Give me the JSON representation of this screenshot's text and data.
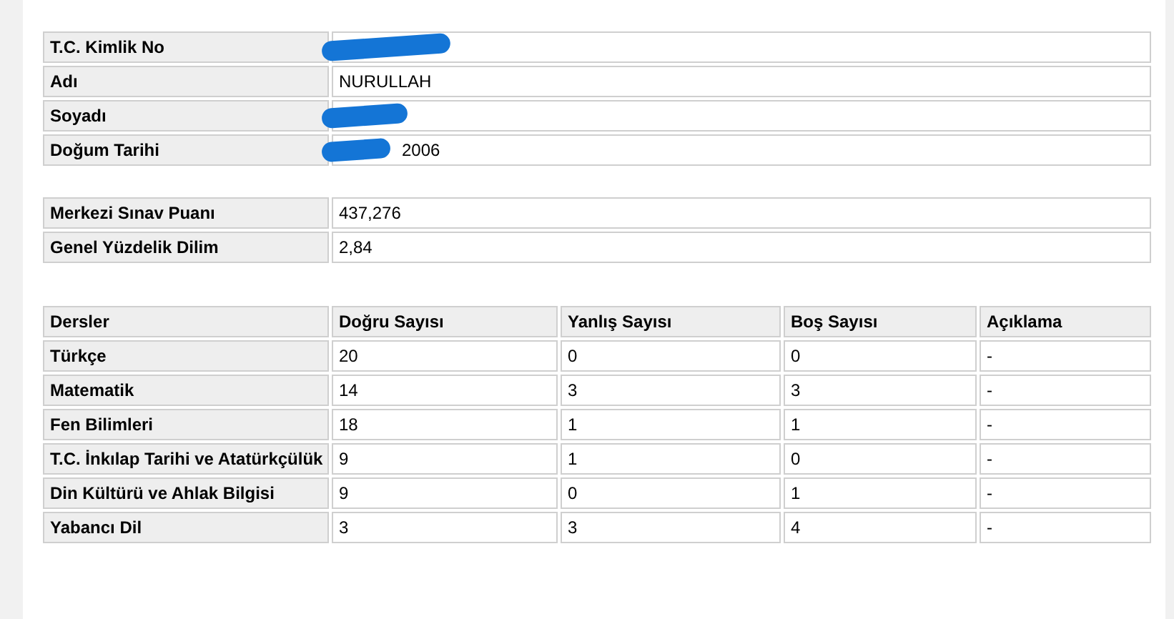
{
  "personal": [
    {
      "label": "T.C. Kimlik No",
      "redacted": true
    },
    {
      "label": "Adı",
      "value": "NURULLAH"
    },
    {
      "label": "Soyadı",
      "redacted": true
    },
    {
      "label": "Doğum Tarihi",
      "value": "2006",
      "redacted": true
    }
  ],
  "scores": [
    {
      "label": "Merkezi Sınav Puanı",
      "value": "437,276"
    },
    {
      "label": "Genel Yüzdelik Dilim",
      "value": "2,84"
    }
  ],
  "results": {
    "columns": [
      "Dersler",
      "Doğru Sayısı",
      "Yanlış Sayısı",
      "Boş Sayısı",
      "Açıklama"
    ],
    "rows": [
      [
        "Türkçe",
        "20",
        "0",
        "0",
        "-"
      ],
      [
        "Matematik",
        "14",
        "3",
        "3",
        "-"
      ],
      [
        "Fen Bilimleri",
        "18",
        "1",
        "1",
        "-"
      ],
      [
        "T.C. İnkılap Tarihi ve Atatürkçülük",
        "9",
        "1",
        "0",
        "-"
      ],
      [
        "Din Kültürü ve Ahlak Bilgisi",
        "9",
        "0",
        "1",
        "-"
      ],
      [
        "Yabancı Dil",
        "3",
        "3",
        "4",
        "-"
      ]
    ]
  }
}
